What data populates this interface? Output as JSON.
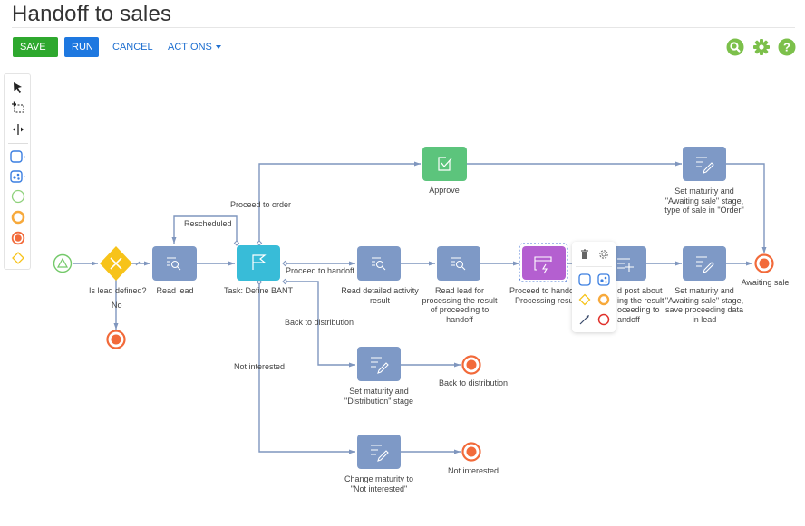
{
  "page": {
    "title": "Handoff to sales"
  },
  "toolbar": {
    "save_label": "SAVE",
    "run_label": "RUN",
    "cancel_label": "CANCEL",
    "actions_label": "ACTIONS",
    "icons": [
      "search-icon",
      "settings-gear-icon",
      "help-icon"
    ]
  },
  "colors": {
    "save": "#2ea82e",
    "run": "#1e78e0",
    "link": "#1e6fd0",
    "accent_green": "#7cc04b",
    "task": "#7e99c6",
    "user_task": "#38bcd8",
    "approve": "#5cc47c",
    "script_task": "#b45fd0",
    "gateway": "#f7c31a",
    "end_event": "#f26a3a",
    "start_event": "#74c96a",
    "flow": "#7f96be"
  },
  "palette": {
    "items": [
      {
        "name": "pointer-tool",
        "label": "Pointer"
      },
      {
        "name": "lasso-tool",
        "label": "Lasso select"
      },
      {
        "name": "space-tool",
        "label": "Space"
      },
      {
        "name": "task-element",
        "label": "Task"
      },
      {
        "name": "subprocess-element",
        "label": "Sub-process"
      },
      {
        "name": "start-event-element",
        "label": "Start event"
      },
      {
        "name": "intermediate-event-element",
        "label": "Intermediate event"
      },
      {
        "name": "end-event-element",
        "label": "End event"
      },
      {
        "name": "gateway-element",
        "label": "Gateway"
      }
    ]
  },
  "diagram": {
    "nodes": {
      "gateway": {
        "label": "Is lead defined?"
      },
      "read_lead": {
        "label": "Read lead"
      },
      "define_bant": {
        "label": "Task: Define BANT"
      },
      "read_activity": {
        "label_l1": "Read detailed activity",
        "label_l2": "result"
      },
      "read_lead_processing": {
        "label_l1": "Read lead for",
        "label_l2": "processing the result",
        "label_l3": "of proceeding to",
        "label_l4": "handoff"
      },
      "proceed_processing": {
        "label_l1": "Proceed to hando",
        "label_l2": "Processing resu"
      },
      "add_post": {
        "label_l1": "d post about",
        "label_l2": "ing the result",
        "label_l3": "oceeding to",
        "label_l4": "andoff"
      },
      "set_maturity_save": {
        "label_l1": "Set maturity and",
        "label_l2": "\"Awaiting sale\" stage,",
        "label_l3": "save proceeding data",
        "label_l4": "in lead"
      },
      "awaiting_sale": {
        "label": "Awaiting sale"
      },
      "approve": {
        "label": "Approve"
      },
      "set_maturity_order": {
        "label_l1": "Set maturity and",
        "label_l2": "\"Awaiting sale\" stage,",
        "label_l3": "type of sale in \"Order\""
      },
      "set_distribution": {
        "label_l1": "Set maturity and",
        "label_l2": "\"Distribution\" stage"
      },
      "back_to_distribution_end": {
        "label": "Back to distribution"
      },
      "change_not_interested": {
        "label_l1": "Change maturity to",
        "label_l2": "\"Not interested\""
      },
      "not_interested_end": {
        "label": "Not interested"
      }
    },
    "flows": {
      "no": "No",
      "rescheduled": "Rescheduled",
      "proceed_to_order": "Proceed to order",
      "proceed_to_handoff": "Proceed to handoff",
      "back_to_distribution": "Back to distribution",
      "not_interested": "Not interested"
    }
  },
  "context_menu": {
    "items": [
      "delete-icon",
      "settings-icon",
      "task-shape",
      "subprocess-shape",
      "gateway-shape",
      "intermediate-event-shape",
      "connector-tool",
      "end-event-shape"
    ]
  }
}
